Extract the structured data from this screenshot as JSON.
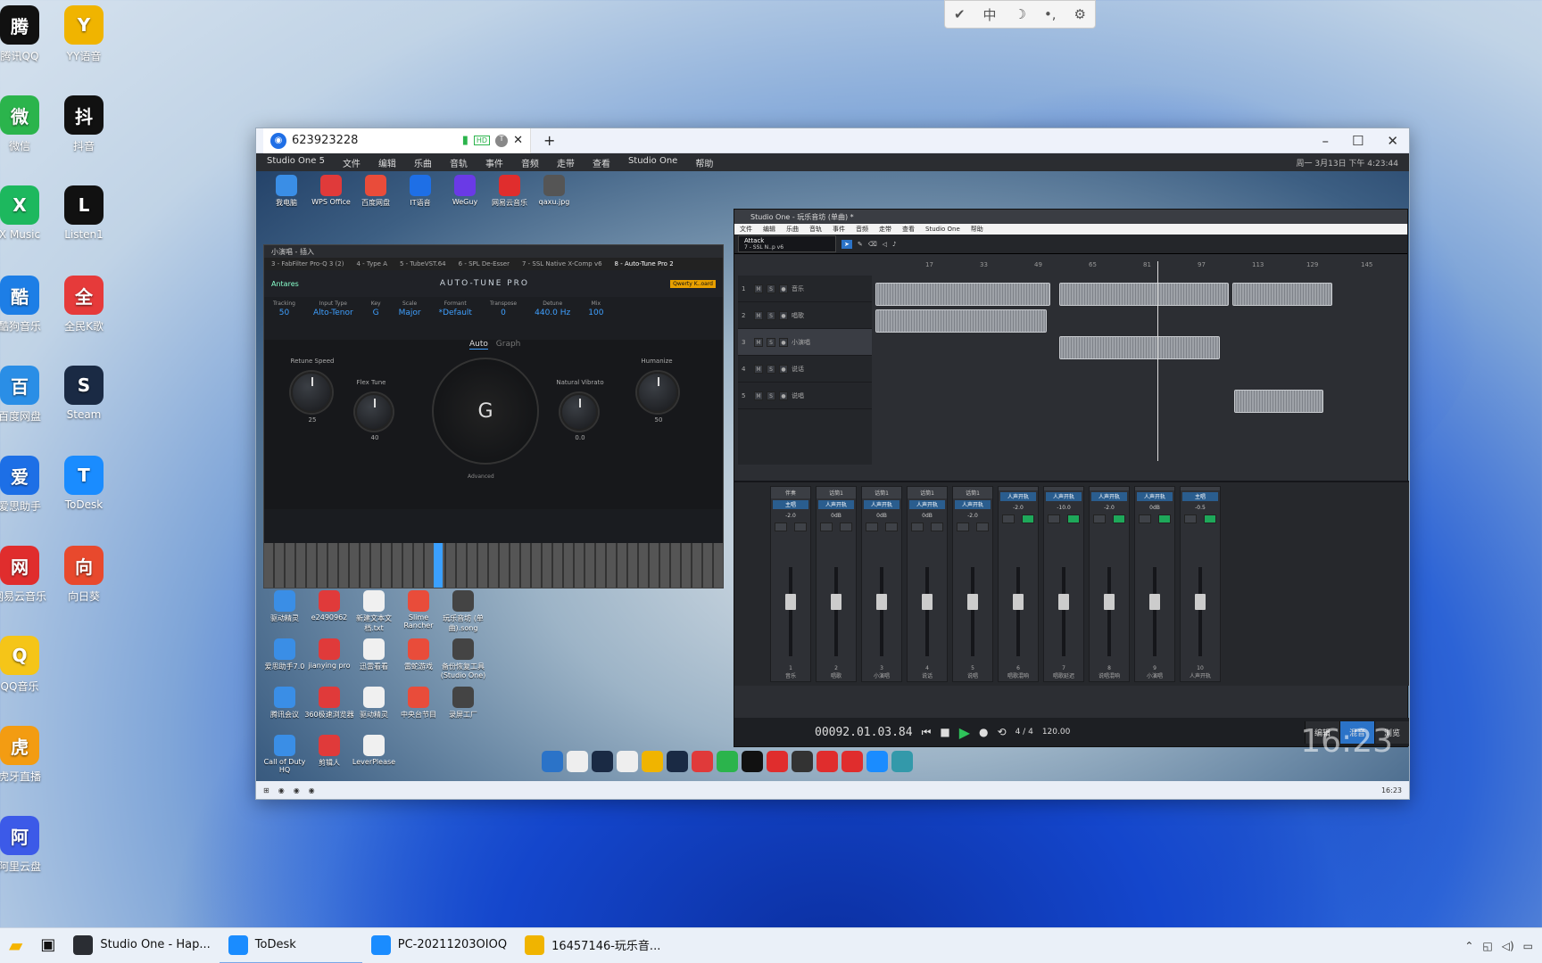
{
  "desktop": {
    "left_col": [
      {
        "label": "腾讯QQ",
        "color": "#111"
      },
      {
        "label": "微信",
        "color": "#2bb44c"
      },
      {
        "label": "X Music",
        "color": "#1db85e"
      },
      {
        "label": "酷狗音乐",
        "color": "#1d7ee6"
      },
      {
        "label": "百度网盘",
        "color": "#2a8ee6"
      },
      {
        "label": "爱思助手",
        "color": "#1d6fe6"
      },
      {
        "label": "网易云音乐",
        "color": "#e02d2d"
      },
      {
        "label": "QQ音乐",
        "color": "#f5c518"
      },
      {
        "label": "虎牙直播",
        "color": "#f39c12"
      },
      {
        "label": "阿里云盘",
        "color": "#3c5ae8"
      }
    ],
    "right_col": [
      {
        "label": "YY语音",
        "color": "#f0b400"
      },
      {
        "label": "抖音",
        "color": "#111"
      },
      {
        "label": "Listen1",
        "color": "#111"
      },
      {
        "label": "全民K歌",
        "color": "#e63a3a"
      },
      {
        "label": "Steam",
        "color": "#1a2a44"
      },
      {
        "label": "ToDesk",
        "color": "#1a8cff"
      },
      {
        "label": "向日葵",
        "color": "#e8492d"
      }
    ]
  },
  "floatbar": {
    "items": [
      "✔",
      "中",
      "☽",
      "•,",
      "⚙"
    ]
  },
  "remote": {
    "tab_id": "623923228",
    "menubar": [
      "Studio One 5",
      "文件",
      "编辑",
      "乐曲",
      "音轨",
      "事件",
      "音频",
      "走带",
      "查看",
      "Studio One",
      "帮助"
    ],
    "status_text": "周一 3月13日 下午 4:23:44",
    "top_icons": [
      "我电脑",
      "WPS Office",
      "百度网盘",
      "IT语音",
      "WeGuy",
      "网易云音乐",
      "qaxu.jpg"
    ],
    "mid_icons": [
      "驱动精灵",
      "e2490962",
      "新建文本文档.txt",
      "Slime Rancher",
      "玩乐音坊 (单曲).song",
      "爱思助手7.0",
      "jianying pro",
      "迅雷看看",
      "雷蛇游戏",
      "备份恢复工具 (Studio One)",
      "腾讯会议",
      "360极速浏览器",
      "驱动精灵",
      "中央台节目",
      "录屏工厂",
      "Call of Duty HQ",
      "剪辑人",
      "LeverPlease"
    ],
    "clock": "16:23",
    "taskbar_time": "16:23"
  },
  "autotune": {
    "panel_title": "小演唱 - 插入",
    "plugin_tabs": [
      "3 - FabFilter Pro-Q 3 (2)",
      "4 - Type A",
      "5 - TubeVST.64",
      "6 - SPL De-Esser",
      "7 - SSL Native X-Comp v6",
      "8 - Auto-Tune Pro 2"
    ],
    "brand": "Antares",
    "title": "AUTO-TUNE PRO",
    "controls": [
      {
        "label": "Tracking",
        "value": "50"
      },
      {
        "label": "Input Type",
        "value": "Alto-Tenor"
      },
      {
        "label": "Key",
        "value": "G"
      },
      {
        "label": "Scale",
        "value": "Major"
      },
      {
        "label": "Formant",
        "value": "*Default"
      },
      {
        "label": "Transpose",
        "value": "0"
      },
      {
        "label": "Detune",
        "value": "440.0 Hz"
      },
      {
        "label": "Mix",
        "value": "100"
      }
    ],
    "mode_auto": "Auto",
    "mode_graph": "Graph",
    "retune_label": "Retune Speed",
    "retune_value": "25",
    "flex_label": "Flex Tune",
    "flex_value": "40",
    "vibrato_label": "Natural Vibrato",
    "vibrato_value": "0.0",
    "humanize_label": "Humanize",
    "humanize_value": "50",
    "pitch": "G",
    "advanced": "Advanced",
    "qwerty": "Qwerty K..oard"
  },
  "studioone": {
    "title": "Studio One - 玩乐音坊 (单曲) *",
    "menu": [
      "文件",
      "编辑",
      "乐曲",
      "音轨",
      "事件",
      "音频",
      "走带",
      "查看",
      "Studio One",
      "帮助"
    ],
    "track_sel": "Attack",
    "track_sub": "7 - SSL N..p v6",
    "ruler": [
      "17",
      "33",
      "49",
      "65",
      "81",
      "97",
      "113",
      "129",
      "145"
    ],
    "tracks": [
      {
        "n": "1",
        "name": "音乐"
      },
      {
        "n": "2",
        "name": "唱歌"
      },
      {
        "n": "3",
        "name": "小演唱"
      },
      {
        "n": "4",
        "name": "说话"
      },
      {
        "n": "5",
        "name": "说唱"
      }
    ],
    "channels": [
      {
        "top": "伴奏",
        "ins": "主唱",
        "vol": "-2.0",
        "n": "1",
        "name": "音乐"
      },
      {
        "top": "话筒1",
        "ins": "人声开轨",
        "vol": "0dB",
        "n": "2",
        "name": "唱歌"
      },
      {
        "top": "话筒1",
        "ins": "人声开轨",
        "vol": "0dB",
        "n": "3",
        "name": "小演唱"
      },
      {
        "top": "话筒1",
        "ins": "人声开轨",
        "vol": "0dB",
        "n": "4",
        "name": "说话"
      },
      {
        "top": "话筒1",
        "ins": "人声开轨",
        "vol": "-2.0",
        "n": "5",
        "name": "说唱"
      },
      {
        "top": "",
        "ins": "人声开轨",
        "vol": "-2.0",
        "n": "6",
        "name": "唱歌混响"
      },
      {
        "top": "",
        "ins": "人声开轨",
        "vol": "-10.0",
        "n": "7",
        "name": "唱歌延迟"
      },
      {
        "top": "",
        "ins": "人声开轨",
        "vol": "-2.0",
        "n": "8",
        "name": "说唱混响"
      },
      {
        "top": "",
        "ins": "人声开轨",
        "vol": "0dB",
        "n": "9",
        "name": "小演唱"
      },
      {
        "top": "",
        "ins": "主唱",
        "vol": "-0.5",
        "n": "10",
        "name": "人声开轨"
      }
    ],
    "time": "00092.01.03.84",
    "time_sig": "4 / 4",
    "tempo": "120.00",
    "page_tabs": [
      "编辑",
      "混音",
      "浏览"
    ]
  },
  "taskbar": {
    "items": [
      {
        "label": "Studio One - Hap...",
        "color": "#2a2d33"
      },
      {
        "label": "ToDesk",
        "color": "#1a8cff"
      },
      {
        "label": "PC-20211203OIOQ",
        "color": "#1a8cff"
      },
      {
        "label": "16457146-玩乐音...",
        "color": "#f0b400"
      }
    ]
  }
}
